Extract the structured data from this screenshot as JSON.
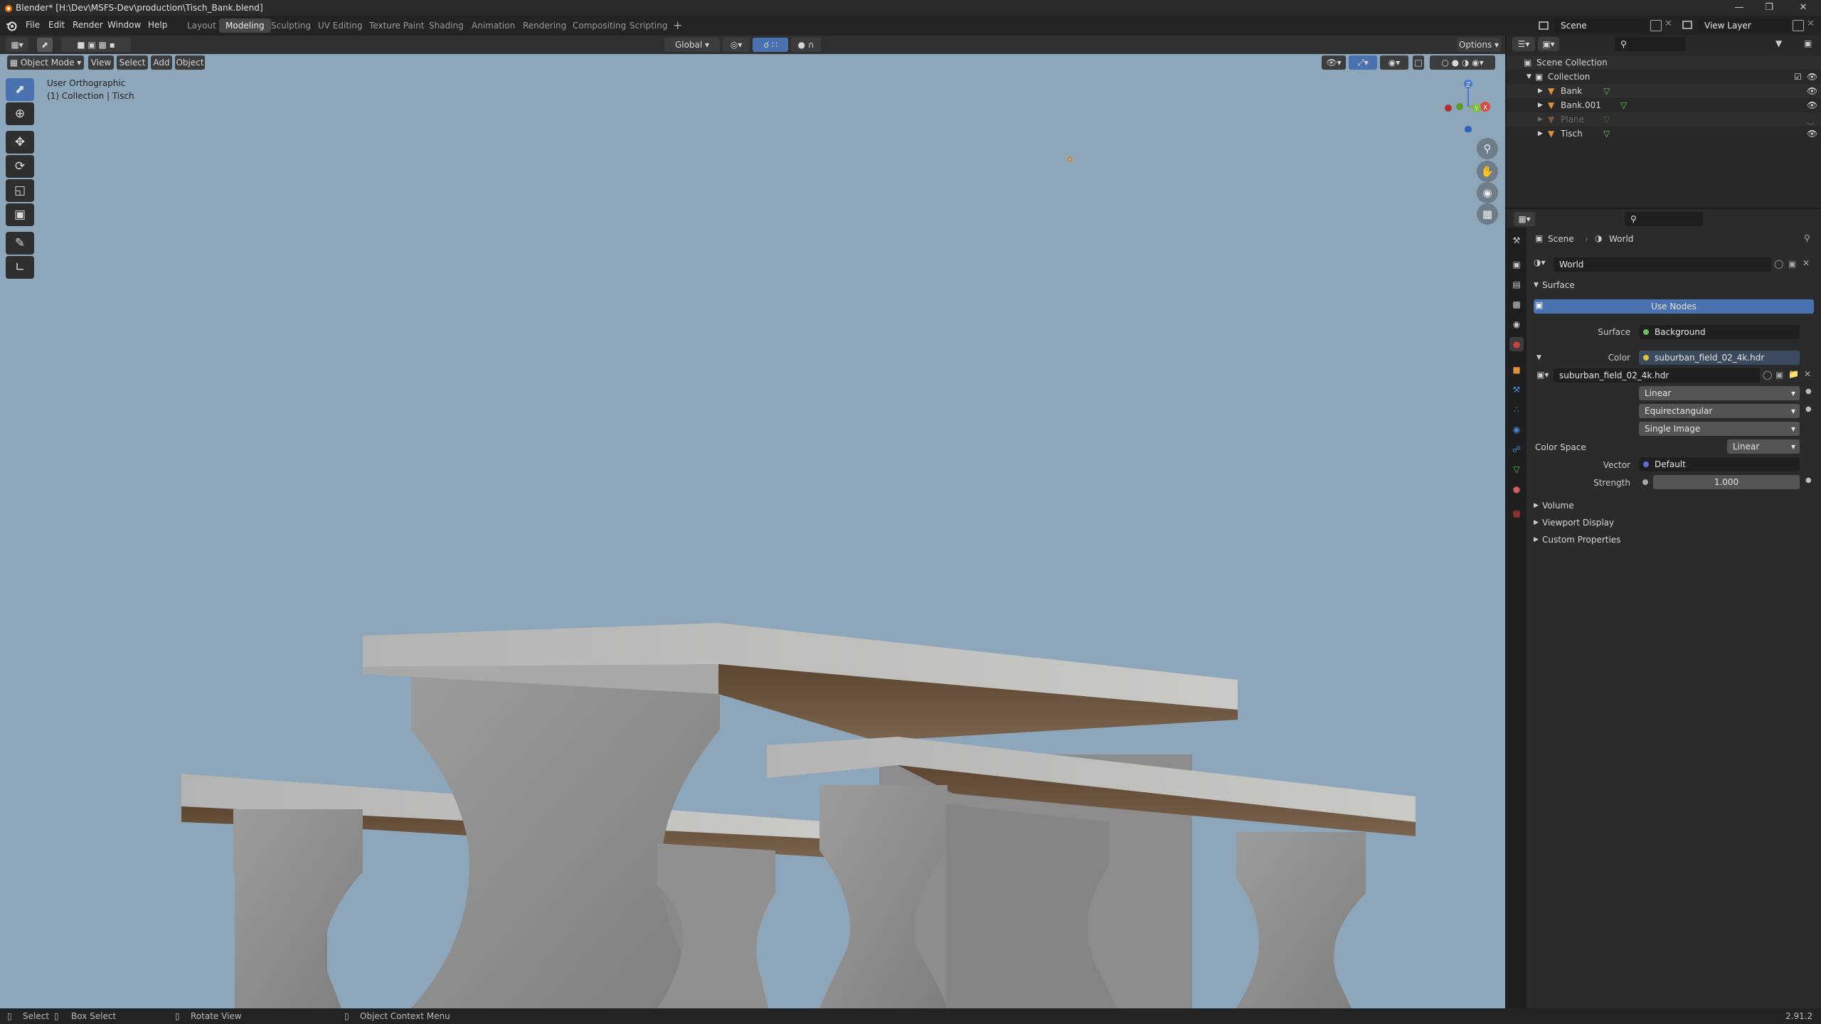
{
  "titlebar": {
    "title": "Blender* [H:\\Dev\\MSFS-Dev\\production\\Tisch_Bank.blend]"
  },
  "menu": {
    "file": "File",
    "edit": "Edit",
    "render": "Render",
    "window": "Window",
    "help": "Help"
  },
  "workspaces": [
    "Layout",
    "Modeling",
    "Sculpting",
    "UV Editing",
    "Texture Paint",
    "Shading",
    "Animation",
    "Rendering",
    "Compositing",
    "Scripting"
  ],
  "active_workspace": "Modeling",
  "scene": {
    "name": "Scene"
  },
  "view_layer": {
    "name": "View Layer"
  },
  "toolbar": {
    "transform_orientation": "Global",
    "options": "Options"
  },
  "viewport_header": {
    "mode": "Object Mode",
    "view": "View",
    "select": "Select",
    "add": "Add",
    "object": "Object"
  },
  "viewport": {
    "view_name": "User Orthographic",
    "context": "(1) Collection | Tisch"
  },
  "gizmo": {
    "x": "X",
    "y": "Y",
    "z": "Z"
  },
  "outliner": {
    "root": "Scene Collection",
    "collection": "Collection",
    "objects": [
      {
        "name": "Bank",
        "dimmed": false
      },
      {
        "name": "Bank.001",
        "dimmed": false
      },
      {
        "name": "Plane",
        "dimmed": true
      },
      {
        "name": "Tisch",
        "dimmed": false
      }
    ]
  },
  "properties": {
    "breadcrumb_scene": "Scene",
    "breadcrumb_world": "World",
    "world_name": "World",
    "surface_panel": "Surface",
    "use_nodes": "Use Nodes",
    "surface_label": "Surface",
    "surface_value": "Background",
    "color_label": "Color",
    "color_value": "suburban_field_02_4k.hdr",
    "image_name": "suburban_field_02_4k.hdr",
    "interpolation": "Linear",
    "projection": "Equirectangular",
    "source": "Single Image",
    "color_space_label": "Color Space",
    "color_space_value": "Linear",
    "vector_label": "Vector",
    "vector_value": "Default",
    "strength_label": "Strength",
    "strength_value": "1.000",
    "panels": [
      "Volume",
      "Viewport Display",
      "Custom Properties"
    ]
  },
  "statusbar": {
    "select": "Select",
    "box_select": "Box Select",
    "rotate_view": "Rotate View",
    "context_menu": "Object Context Menu",
    "version": "2.91.2"
  },
  "colors": {
    "accent": "#4a72b0",
    "viewport_bg": "#8ea6b9",
    "panel_bg": "#2b2b2b"
  }
}
